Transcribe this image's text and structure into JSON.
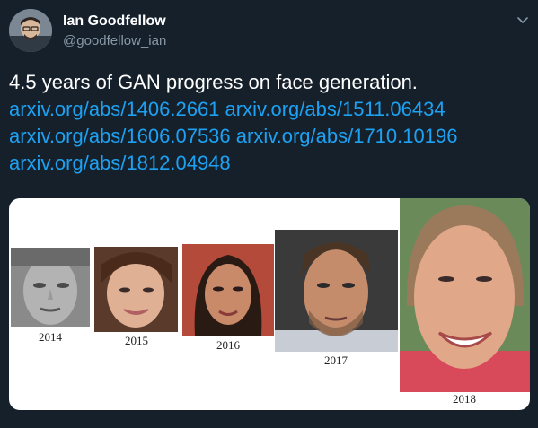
{
  "author": {
    "name": "Ian Goodfellow",
    "handle": "@goodfellow_ian"
  },
  "icons": {
    "menu": "chevron-down-icon"
  },
  "tweet": {
    "text": "4.5 years of GAN progress on face generation.",
    "links": [
      "arxiv.org/abs/1406.2661",
      "arxiv.org/abs/1511.06434",
      "arxiv.org/abs/1606.07536",
      "arxiv.org/abs/1710.10196",
      "arxiv.org/abs/1812.04948"
    ]
  },
  "media": {
    "years": [
      "2014",
      "2015",
      "2016",
      "2017",
      "2018"
    ]
  },
  "colors": {
    "background": "#15202b",
    "link": "#1da1f2",
    "secondary_text": "#8899a6"
  }
}
